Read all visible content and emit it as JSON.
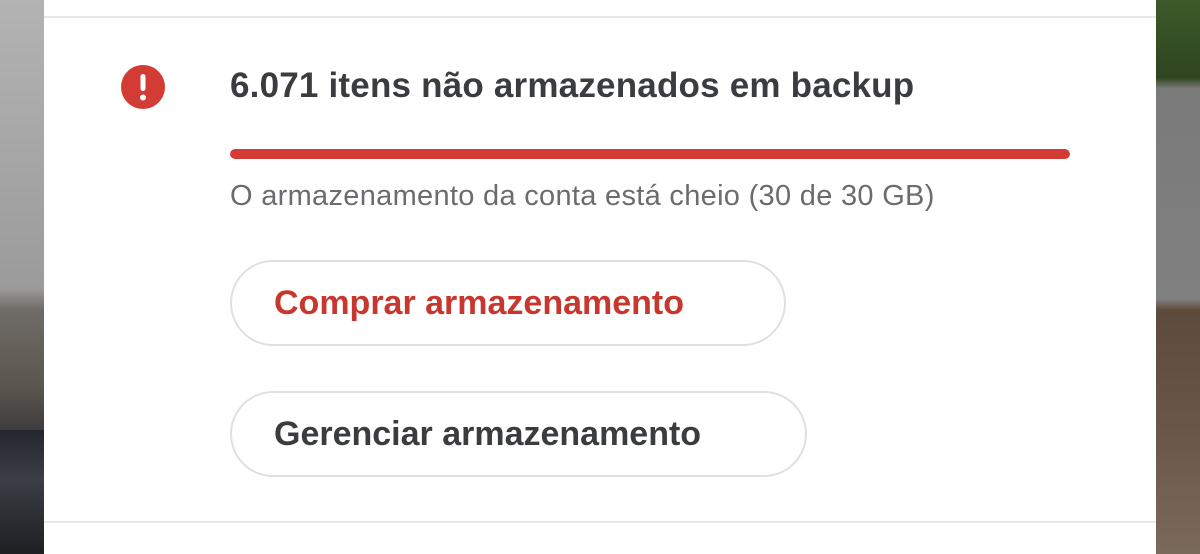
{
  "colors": {
    "accent_red": "#d23c34",
    "text_dark": "#3b3c3f",
    "text_muted": "#6b6c70",
    "border": "#dfe0e2"
  },
  "backup_status": {
    "icon": "alert-circle-icon",
    "title": "6.071 itens não armazenados em backup",
    "storage_used_fraction": 1.0,
    "subtitle": "O armazenamento da conta está cheio (30 de 30 GB)"
  },
  "actions": {
    "buy_storage_label": "Comprar armazenamento",
    "manage_storage_label": "Gerenciar armazenamento"
  }
}
